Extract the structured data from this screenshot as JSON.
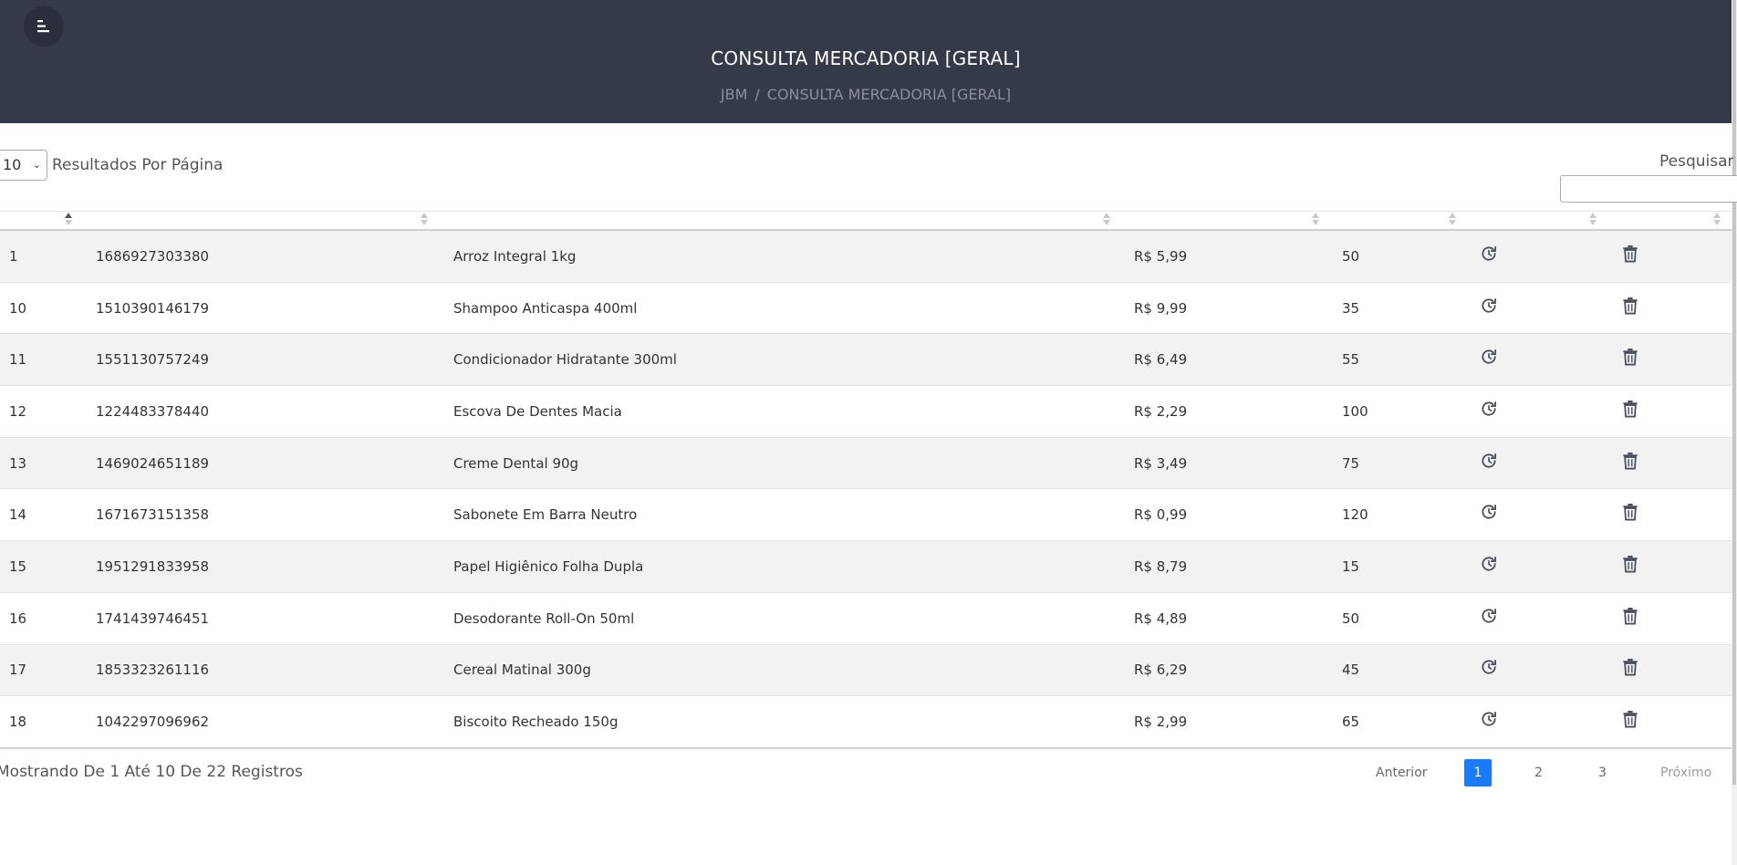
{
  "header": {
    "title": "CONSULTA MERCADORIA [GERAL]",
    "breadcrumb": {
      "home": "JBM",
      "separator": "/",
      "current": "CONSULTA MERCADORIA [GERAL]"
    },
    "menu_icon": "menu-icon"
  },
  "controls": {
    "page_length": "10",
    "page_length_label": "Resultados Por Página",
    "search_label": "Pesquisar",
    "search_value": ""
  },
  "table": {
    "sorted_column": 0,
    "rows": [
      {
        "id": "1",
        "code": "1686927303380",
        "name": "Arroz Integral 1kg",
        "price": "R$ 5,99",
        "qty": "50"
      },
      {
        "id": "10",
        "code": "1510390146179",
        "name": "Shampoo Anticaspa 400ml",
        "price": "R$ 9,99",
        "qty": "35"
      },
      {
        "id": "11",
        "code": "1551130757249",
        "name": "Condicionador Hidratante 300ml",
        "price": "R$ 6,49",
        "qty": "55"
      },
      {
        "id": "12",
        "code": "1224483378440",
        "name": "Escova De Dentes Macia",
        "price": "R$ 2,29",
        "qty": "100"
      },
      {
        "id": "13",
        "code": "1469024651189",
        "name": "Creme Dental 90g",
        "price": "R$ 3,49",
        "qty": "75"
      },
      {
        "id": "14",
        "code": "1671673151358",
        "name": "Sabonete Em Barra Neutro",
        "price": "R$ 0,99",
        "qty": "120"
      },
      {
        "id": "15",
        "code": "1951291833958",
        "name": "Papel Higiênico Folha Dupla",
        "price": "R$ 8,79",
        "qty": "15"
      },
      {
        "id": "16",
        "code": "1741439746451",
        "name": "Desodorante Roll-On 50ml",
        "price": "R$ 4,89",
        "qty": "50"
      },
      {
        "id": "17",
        "code": "1853323261116",
        "name": "Cereal Matinal 300g",
        "price": "R$ 6,29",
        "qty": "45"
      },
      {
        "id": "18",
        "code": "1042297096962",
        "name": "Biscoito Recheado 150g",
        "price": "R$ 2,99",
        "qty": "65"
      }
    ],
    "row_action_icons": [
      "history-icon",
      "trash-icon"
    ]
  },
  "footer": {
    "info": "Mostrando De 1 Até 10 De 22 Registros",
    "pagination": {
      "previous": "Anterior",
      "pages": [
        "1",
        "2",
        "3"
      ],
      "current": "1",
      "next": "Próximo"
    }
  },
  "colors": {
    "header_bg": "#353a48",
    "accent": "#1a7bff",
    "stripe": "#f2f2f2"
  }
}
